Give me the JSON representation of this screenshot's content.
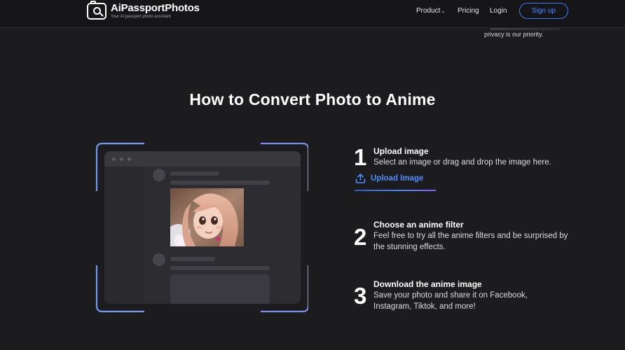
{
  "header": {
    "logo_name": "AiPassportPhotos",
    "logo_tagline": "Your AI passport photo assistant",
    "nav": {
      "product": "Product",
      "pricing": "Pricing",
      "login": "Login",
      "signup": "Sign up"
    }
  },
  "top_snippet": "privacy is our priority.",
  "section": {
    "title": "How to Convert Photo to Anime"
  },
  "steps": [
    {
      "number": "1",
      "title": "Upload image",
      "description": "Select an image or drag and drop the image here.",
      "link_label": "Upload Image"
    },
    {
      "number": "2",
      "title": "Choose an anime filter",
      "description": "Feel free to try all the anime filters and be surprised by the stunning effects."
    },
    {
      "number": "3",
      "title": "Download the anime image",
      "description": "Save your photo and share it on Facebook, Instagram, Tiktok, and more!"
    }
  ],
  "colors": {
    "accent": "#4d8cf8",
    "background": "#1c1c1e",
    "header_bg": "#161618"
  },
  "icons": {
    "logo": "camera-search-icon",
    "product_chevron": "chevron-down-icon",
    "upload": "upload-icon"
  }
}
